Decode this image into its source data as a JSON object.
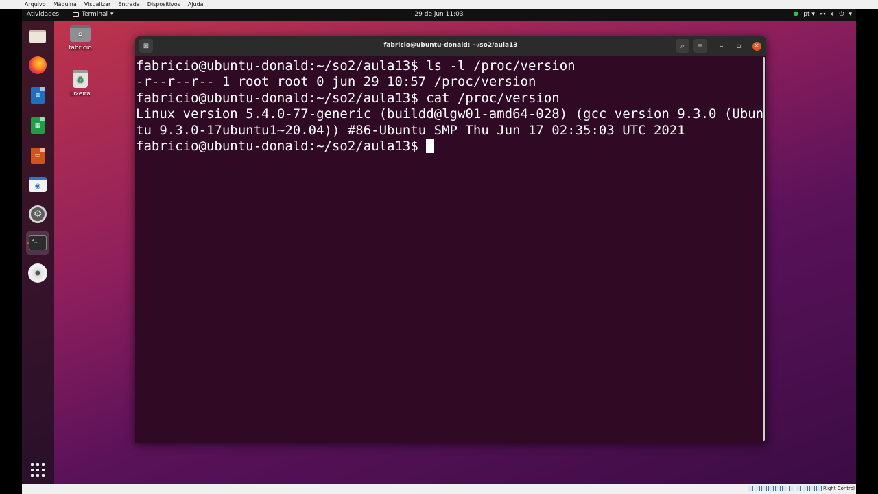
{
  "vbox_menu": [
    "Arquivo",
    "Máquina",
    "Visualizar",
    "Entrada",
    "Dispositivos",
    "Ajuda"
  ],
  "topbar": {
    "activities": "Atividades",
    "app_name": "Terminal",
    "app_arrow": "▾",
    "clock": "29 de jun  11:03",
    "keyboard_layout": "pt",
    "tray_arrow": "▾"
  },
  "desktop_icons": {
    "home_label": "fabricio",
    "trash_label": "Lixeira"
  },
  "dock": {
    "items": [
      "files",
      "firefox",
      "libreoffice-writer",
      "libreoffice-calc",
      "libreoffice-impress",
      "software-store",
      "settings",
      "terminal",
      "optical-disc"
    ]
  },
  "terminal": {
    "title": "fabricio@ubuntu-donald: ~/so2/aula13",
    "lines": [
      "fabricio@ubuntu-donald:~/so2/aula13$ ls -l /proc/version",
      "-r--r--r-- 1 root root 0 jun 29 10:57 /proc/version",
      "fabricio@ubuntu-donald:~/so2/aula13$ cat /proc/version",
      "Linux version 5.4.0-77-generic (buildd@lgw01-amd64-028) (gcc version 9.3.0 (Ubun",
      "tu 9.3.0-17ubuntu1~20.04)) #86-Ubuntu SMP Thu Jun 17 02:35:03 UTC 2021"
    ],
    "prompt": "fabricio@ubuntu-donald:~/so2/aula13$ "
  },
  "vbox_status": {
    "host_key": "Right Control"
  },
  "colors": {
    "terminal_bg": "#300a24",
    "accent": "#e95420",
    "titlebar": "#2b2b2b"
  }
}
